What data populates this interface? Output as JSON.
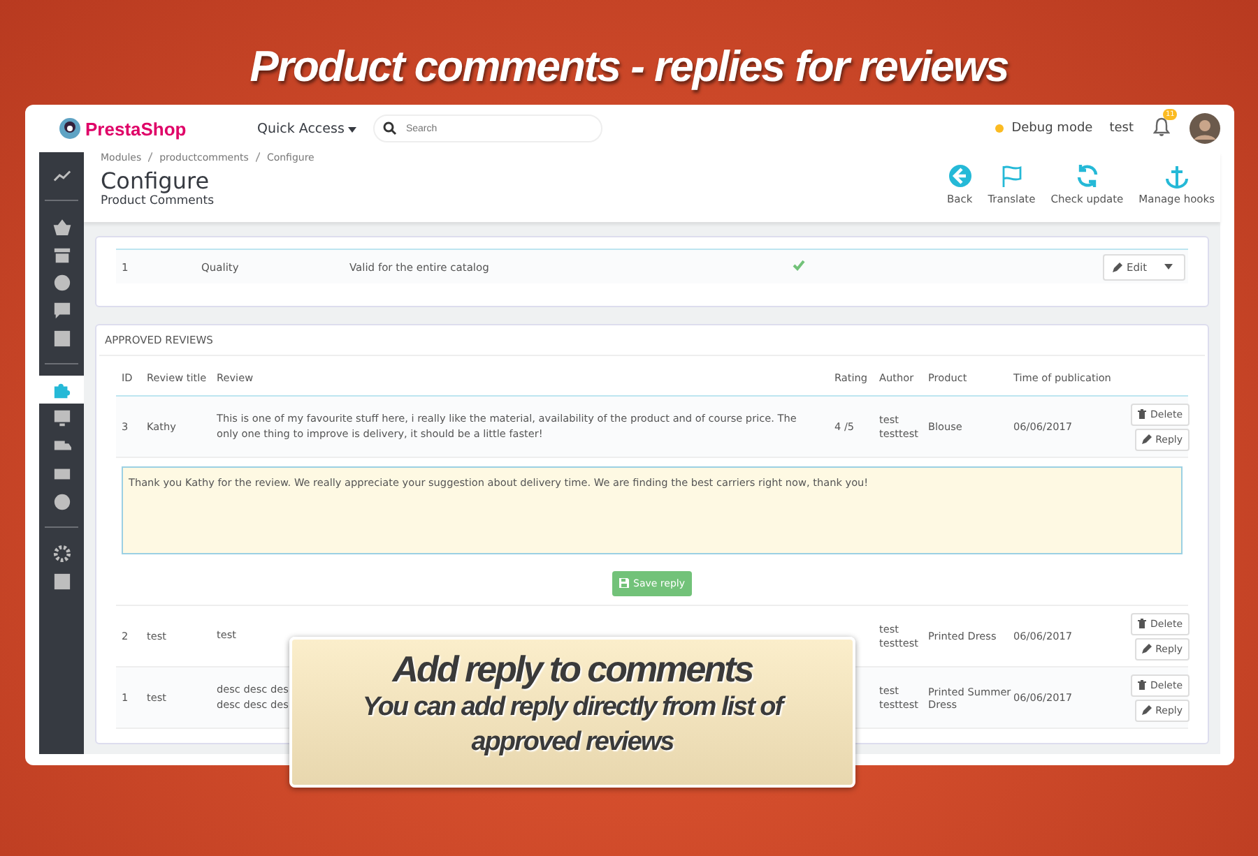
{
  "headline": "Product comments - replies for reviews",
  "topbar": {
    "logo": "PrestaShop",
    "quick_access": "Quick Access",
    "search": {
      "placeholder": "Search"
    },
    "debug": "Debug mode",
    "user": "test",
    "notifications": "11"
  },
  "sidebar": {
    "items": [
      {
        "selected": false
      },
      {
        "selected": false
      },
      {
        "selected": false
      },
      {
        "selected": false
      },
      {
        "selected": false
      },
      {
        "selected": false
      },
      {
        "selected": true
      },
      {
        "selected": false
      },
      {
        "selected": false
      },
      {
        "selected": false
      },
      {
        "selected": false
      },
      {
        "selected": false
      },
      {
        "selected": false
      }
    ]
  },
  "breadcrumb": [
    "Modules",
    "productcomments",
    "Configure"
  ],
  "page_title": "Configure",
  "page_subtitle": "Product Comments",
  "toolbar": [
    "Back",
    "Translate",
    "Check update",
    "Manage hooks"
  ],
  "criteria": {
    "rows": [
      {
        "id": "1",
        "name": "Quality",
        "type": "Valid for the entire catalog",
        "status": true,
        "action": "Edit"
      }
    ]
  },
  "approved": {
    "title": "APPROVED REVIEWS",
    "columns": [
      "ID",
      "Review title",
      "Review",
      "Rating",
      "Author",
      "Product",
      "Time of publication"
    ],
    "rows": [
      {
        "id": "3",
        "title": "Kathy",
        "review": "This is one of my favourite stuff here, i really like the material, availability of the product and of course price. The only one thing to improve is delivery, it should be a little faster!",
        "rating": "4 /5",
        "author": [
          "test",
          "testtest"
        ],
        "product": "Blouse",
        "time": "06/06/2017",
        "expanded": true,
        "delete": "Delete",
        "reply": "Reply"
      },
      {
        "id": "2",
        "title": "test",
        "review": "test",
        "rating": "",
        "author": [
          "test",
          "testtest"
        ],
        "product": "Printed Dress",
        "time": "06/06/2017",
        "expanded": false,
        "delete": "Delete",
        "reply": "Reply"
      },
      {
        "id": "1",
        "title": "test",
        "review": "desc desc des\ndesc desc des",
        "rating": "",
        "author": [
          "test",
          "testtest"
        ],
        "product": "Printed Summer Dress",
        "time": "06/06/2017",
        "expanded": false,
        "delete": "Delete",
        "reply": "Reply"
      }
    ],
    "reply": {
      "value": "Thank you Kathy for the review. We really appreciate your suggestion about delivery time. We are finding the best carriers right now, thank you!",
      "save": "Save reply"
    }
  },
  "callout": {
    "title": "Add reply to comments",
    "text": "You can add reply directly from list of approved reviews"
  }
}
